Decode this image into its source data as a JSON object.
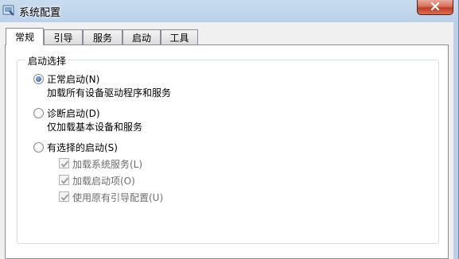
{
  "window": {
    "title": "系统配置",
    "close_symbol": "✕"
  },
  "tabs": [
    {
      "label": "常规",
      "active": true
    },
    {
      "label": "引导",
      "active": false
    },
    {
      "label": "服务",
      "active": false
    },
    {
      "label": "启动",
      "active": false
    },
    {
      "label": "工具",
      "active": false
    }
  ],
  "startup_selection": {
    "group_label": "启动选择",
    "options": [
      {
        "label": "正常启动(N)",
        "description": "加载所有设备驱动程序和服务",
        "selected": true
      },
      {
        "label": "诊断启动(D)",
        "description": "仅加载基本设备和服务",
        "selected": false
      },
      {
        "label": "有选择的启动(S)",
        "description": "",
        "selected": false
      }
    ],
    "selective_items": [
      {
        "label": "加载系统服务(L)",
        "checked": true,
        "enabled": false
      },
      {
        "label": "加载启动项(O)",
        "checked": true,
        "enabled": false
      },
      {
        "label": "使用原有引导配置(U)",
        "checked": true,
        "enabled": false
      }
    ]
  },
  "colors": {
    "title_gradient": "#c9dcef",
    "radio_fill": "#1d4f9a",
    "close_button": "#c23c25"
  }
}
